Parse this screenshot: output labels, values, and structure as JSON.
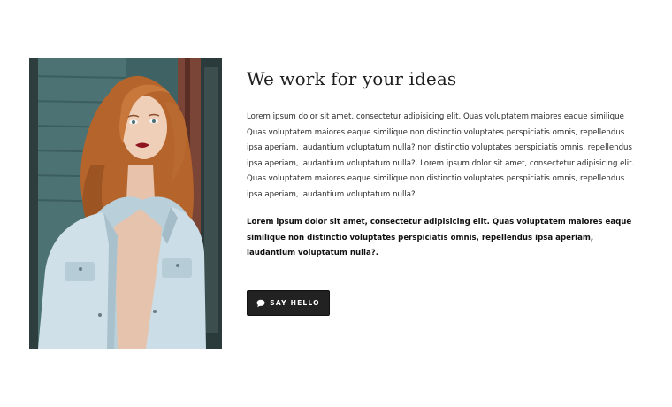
{
  "section": {
    "heading": "We work for your ideas",
    "paragraph": "Lorem ipsum dolor sit amet, consectetur adipisicing elit. Quas voluptatem maiores eaque similique Quas voluptatem maiores eaque similique non distinctio voluptates perspiciatis omnis, repellendus ipsa aperiam, laudantium voluptatum nulla? non distinctio voluptates perspiciatis omnis, repellendus ipsa aperiam, laudantium voluptatum nulla?. Lorem ipsum dolor sit amet, consectetur adipisicing elit. Quas voluptatem maiores eaque similique non distinctio voluptates perspiciatis omnis, repellendus ipsa aperiam, laudantium voluptatum nulla?",
    "bold_paragraph": "Lorem ipsum dolor sit amet, consectetur adipisicing elit. Quas voluptatem maiores eaque similique non distinctio voluptates perspiciatis omnis, repellendus ipsa aperiam, laudantium voluptatum nulla?.",
    "button": {
      "label": "SAY HELLO",
      "icon": "chat-bubble-icon"
    }
  },
  "colors": {
    "button_bg": "#222222",
    "button_text": "#ffffff",
    "heading": "#1e1e1e",
    "body_text": "#2a2a2a"
  }
}
